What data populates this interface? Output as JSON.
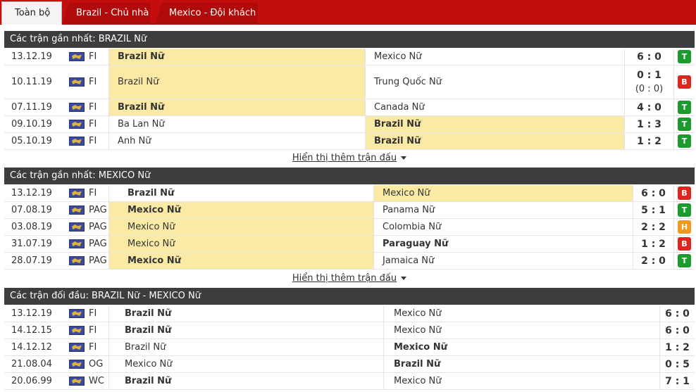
{
  "tabs": [
    "Toàn bộ",
    "Brazil - Chủ nhà",
    "Mexico - Đội khách"
  ],
  "show_more": "Hiển thị thêm trận đấu",
  "sections": [
    {
      "title": "Các trận gần nhất: BRAZIL Nữ",
      "rows": [
        {
          "date": "13.12.19",
          "comp": "FI",
          "home": "Brazil Nữ",
          "away": "Mexico Nữ",
          "score": "6 : 0",
          "ht": "",
          "result": "T",
          "hl": "home",
          "bold": "home"
        },
        {
          "date": "10.11.19",
          "comp": "FI",
          "home": "Brazil Nữ",
          "away": "Trung Quốc Nữ",
          "score": "0 : 1",
          "ht": "(0 : 0)",
          "result": "B",
          "hl": "home",
          "bold": ""
        },
        {
          "date": "07.11.19",
          "comp": "FI",
          "home": "Brazil Nữ",
          "away": "Canada Nữ",
          "score": "4 : 0",
          "ht": "",
          "result": "T",
          "hl": "home",
          "bold": "home"
        },
        {
          "date": "09.10.19",
          "comp": "FI",
          "home": "Ba Lan Nữ",
          "away": "Brazil Nữ",
          "score": "1 : 3",
          "ht": "",
          "result": "T",
          "hl": "away",
          "bold": "away"
        },
        {
          "date": "05.10.19",
          "comp": "FI",
          "home": "Anh Nữ",
          "away": "Brazil Nữ",
          "score": "1 : 2",
          "ht": "",
          "result": "T",
          "hl": "away",
          "bold": "away"
        }
      ]
    },
    {
      "title": "Các trận gần nhất: MEXICO Nữ",
      "rows": [
        {
          "date": "13.12.19",
          "comp": "FI",
          "home": "Brazil Nữ",
          "away": "Mexico Nữ",
          "score": "6 : 0",
          "ht": "",
          "result": "B",
          "hl": "away",
          "bold": "home"
        },
        {
          "date": "07.08.19",
          "comp": "PAG",
          "home": "Mexico Nữ",
          "away": "Panama Nữ",
          "score": "5 : 1",
          "ht": "",
          "result": "T",
          "hl": "home",
          "bold": "home"
        },
        {
          "date": "03.08.19",
          "comp": "PAG",
          "home": "Mexico Nữ",
          "away": "Colombia Nữ",
          "score": "2 : 2",
          "ht": "",
          "result": "H",
          "hl": "home",
          "bold": ""
        },
        {
          "date": "31.07.19",
          "comp": "PAG",
          "home": "Mexico Nữ",
          "away": "Paraguay Nữ",
          "score": "1 : 2",
          "ht": "",
          "result": "B",
          "hl": "home",
          "bold": "away"
        },
        {
          "date": "28.07.19",
          "comp": "PAG",
          "home": "Mexico Nữ",
          "away": "Jamaica Nữ",
          "score": "2 : 0",
          "ht": "",
          "result": "T",
          "hl": "home",
          "bold": "home"
        }
      ]
    },
    {
      "title": "Các trận đối đầu: BRAZIL Nữ - MEXICO Nữ",
      "rows": [
        {
          "date": "13.12.19",
          "comp": "FI",
          "home": "Brazil Nữ",
          "away": "Mexico Nữ",
          "score": "6 : 0",
          "bold": "home"
        },
        {
          "date": "14.12.15",
          "comp": "FI",
          "home": "Brazil Nữ",
          "away": "Mexico Nữ",
          "score": "6 : 0",
          "bold": "home"
        },
        {
          "date": "14.12.12",
          "comp": "FI",
          "home": "Brazil Nữ",
          "away": "Mexico Nữ",
          "score": "1 : 2",
          "bold": "away"
        },
        {
          "date": "21.08.04",
          "comp": "OG",
          "home": "Mexico Nữ",
          "away": "Brazil Nữ",
          "score": "0 : 5",
          "bold": "away"
        },
        {
          "date": "20.06.99",
          "comp": "WC",
          "home": "Brazil Nữ",
          "away": "Mexico Nữ",
          "score": "7 : 1",
          "bold": "home"
        }
      ]
    }
  ]
}
